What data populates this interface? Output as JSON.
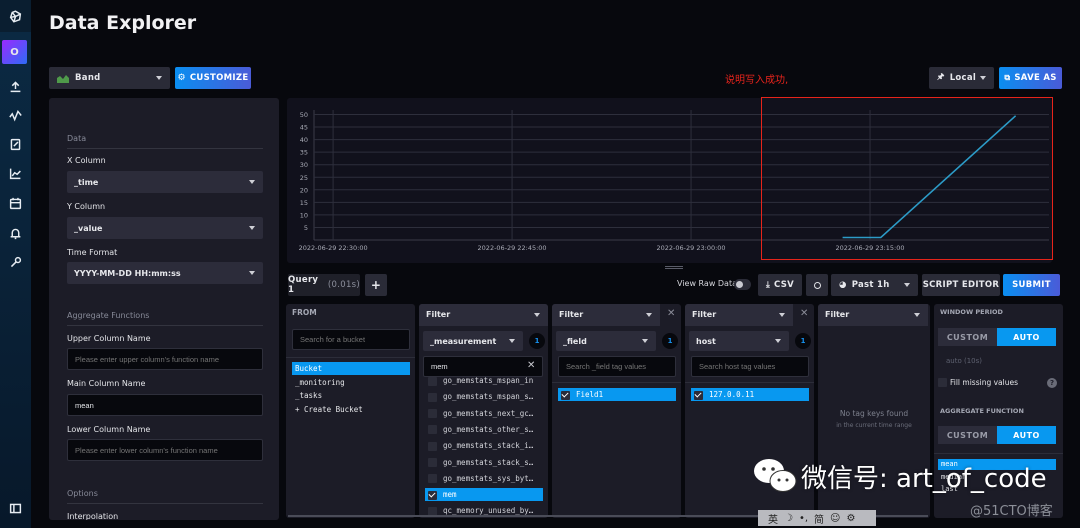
{
  "app": {
    "title": "Data Explorer",
    "org_initial": "O"
  },
  "nav": {
    "items": [
      "logo-icon",
      "upload-icon",
      "graph-icon",
      "notebook-icon",
      "dashboards-icon",
      "tasks-icon",
      "alerts-icon",
      "settings-wrench-icon"
    ],
    "footer": "collapse-icon"
  },
  "toolbar": {
    "vis_type": "Band",
    "customize": "CUSTOMIZE",
    "local": "Local",
    "save_as": "SAVE AS",
    "annotation": "说明写入成功,"
  },
  "settings": {
    "data_section": "Data",
    "x_column_label": "X Column",
    "x_column_value": "_time",
    "y_column_label": "Y Column",
    "y_column_value": "_value",
    "time_format_label": "Time Format",
    "time_format_value": "YYYY-MM-DD HH:mm:ss",
    "aggregate_section": "Aggregate Functions",
    "upper_label": "Upper Column Name",
    "upper_placeholder": "Please enter upper column's function name",
    "main_label": "Main Column Name",
    "main_value": "mean",
    "lower_label": "Lower Column Name",
    "lower_placeholder": "Please enter lower column's function name",
    "options_section": "Options",
    "interpolation_label": "Interpolation"
  },
  "chart_data": {
    "type": "line",
    "title": "",
    "xlabel": "",
    "ylabel": "",
    "x_ticks": [
      "2022-06-29 22:30:00",
      "2022-06-29 22:45:00",
      "2022-06-29 23:00:00",
      "2022-06-29 23:15:00"
    ],
    "y_ticks": [
      5,
      10,
      15,
      20,
      25,
      30,
      35,
      40,
      45,
      50
    ],
    "ylim": [
      0,
      51
    ],
    "xlim_minutes_from_2230": [
      -1.6,
      60
    ],
    "grid": true,
    "series": [
      {
        "name": "mean",
        "color": "#2c9bc7",
        "x_minutes_from_2230": [
          42.7,
          45.9,
          57.2
        ],
        "values": [
          1,
          1,
          49.5
        ]
      }
    ]
  },
  "query": {
    "tab_label": "Query 1",
    "tab_time": "(0.01s)",
    "add": "+",
    "view_raw": "View Raw Data",
    "csv": "CSV",
    "time_range": "Past 1h",
    "script_editor": "SCRIPT EDITOR",
    "submit": "SUBMIT"
  },
  "from": {
    "header": "FROM",
    "search_placeholder": "Search for a bucket",
    "buckets": [
      "Bucket",
      "_monitoring",
      "_tasks",
      "+ Create Bucket"
    ],
    "selected": 0
  },
  "filters": [
    {
      "header": "Filter",
      "key": "_measurement",
      "count": "1",
      "search_value": "mem",
      "items": [
        {
          "label": "go_memstats_mspan_in",
          "checked": false
        },
        {
          "label": "go_memstats_mspan_s…",
          "checked": false
        },
        {
          "label": "go_memstats_next_gc…",
          "checked": false
        },
        {
          "label": "go_memstats_other_s…",
          "checked": false
        },
        {
          "label": "go_memstats_stack_i…",
          "checked": false
        },
        {
          "label": "go_memstats_stack_s…",
          "checked": false
        },
        {
          "label": "go_memstats_sys_byt…",
          "checked": false
        },
        {
          "label": "mem",
          "checked": true
        },
        {
          "label": "qc_memory_unused_by…",
          "checked": false
        }
      ]
    },
    {
      "header": "Filter",
      "key": "_field",
      "count": "1",
      "search_placeholder": "Search _field tag values",
      "items": [
        {
          "label": "Field1",
          "checked": true
        }
      ]
    },
    {
      "header": "Filter",
      "key": "host",
      "count": "1",
      "search_placeholder": "Search host tag values",
      "items": [
        {
          "label": "127.0.0.11",
          "checked": true
        }
      ]
    },
    {
      "header": "Filter",
      "empty_title": "No tag keys found",
      "empty_sub": "in the current time range"
    }
  ],
  "window": {
    "period_header": "WINDOW PERIOD",
    "custom": "CUSTOM",
    "auto": "AUTO",
    "auto_value": "auto (10s)",
    "fill_missing": "Fill missing values",
    "agg_header": "AGGREGATE FUNCTION",
    "functions": [
      "mean",
      "median",
      "last"
    ],
    "selected_function": 0
  },
  "overlay": {
    "watermark": "微信号: art_of_code",
    "ime": [
      "英",
      "☽",
      "•,",
      "简",
      "☺",
      "⚙"
    ],
    "site": "@51CTO博客"
  }
}
